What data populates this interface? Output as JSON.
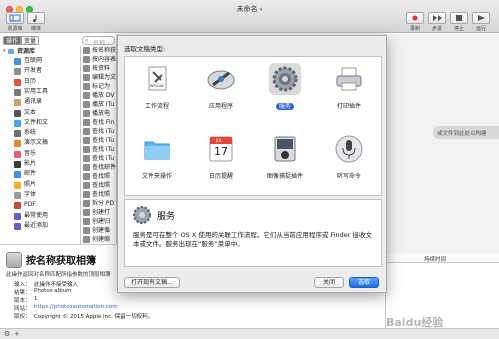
{
  "window": {
    "title": "未命名",
    "title_suffix": "▾"
  },
  "toolbar": {
    "library_label": "资源库",
    "media_label": "媒体",
    "record_label": "录制",
    "step_label": "步进",
    "stop_label": "停止",
    "run_label": "运行"
  },
  "tabs": {
    "actions": "操作",
    "variables": "变量"
  },
  "search": {
    "placeholder": "名称"
  },
  "library": {
    "header": "资源库",
    "items": [
      {
        "label": "互联网",
        "color": "#4a90d9"
      },
      {
        "label": "开发者",
        "color": "#8e8e93"
      },
      {
        "label": "日历",
        "color": "#e5533d"
      },
      {
        "label": "实用工具",
        "color": "#7a7a7a"
      },
      {
        "label": "通讯录",
        "color": "#c8a06a"
      },
      {
        "label": "文本",
        "color": "#555555"
      },
      {
        "label": "文件和文件夹",
        "color": "#4aa3f0"
      },
      {
        "label": "系统",
        "color": "#6d6d6d"
      },
      {
        "label": "演示文稿",
        "color": "#e08a2c"
      },
      {
        "label": "音乐",
        "color": "#f25a7a"
      },
      {
        "label": "影片",
        "color": "#3b3b3b"
      },
      {
        "label": "邮件",
        "color": "#3d8fe8"
      },
      {
        "label": "照片",
        "color": "#f0b429"
      },
      {
        "label": "字体",
        "color": "#9a9a9a"
      },
      {
        "label": "PDF",
        "color": "#c94b3b"
      },
      {
        "label": "最常使用的",
        "color": "#6a5acd"
      },
      {
        "label": "最近添加",
        "color": "#6a5acd"
      }
    ]
  },
  "actions": {
    "items": [
      "按名称获",
      "按内容表",
      "按资料",
      "编辑为文",
      "标记为",
      "播放 DV",
      "播放 iTu",
      "播放电",
      "查找 Fin",
      "查找 iTu",
      "查找 iTu",
      "查找 iTu",
      "查找 iTu",
      "查找邮件",
      "查找照",
      "查找照",
      "查找照",
      "拆分 PD",
      "创建打",
      "创建归",
      "创建循",
      "创建缩"
    ]
  },
  "info": {
    "title": "按名称获取相簿",
    "description": "此操作返回对名称匹配所指参数的顶层相簿",
    "rows": [
      {
        "k": "输入：",
        "v": "此操作不接受输入"
      },
      {
        "k": "结果：",
        "v": "Photos album"
      },
      {
        "k": "版本：",
        "v": "1"
      },
      {
        "k": "网站：",
        "v": "https://photosautomation.com"
      },
      {
        "k": "版权：",
        "v": "Copyright © 2015 Apple Inc. 保留一切权利。"
      }
    ]
  },
  "log": {
    "column": "持续时间",
    "hint": "或文件到此处以构建"
  },
  "dialog": {
    "title": "选取文稿类型:",
    "types": [
      {
        "label": "工作流程",
        "icon": "workflow-icon"
      },
      {
        "label": "应用程序",
        "icon": "application-icon"
      },
      {
        "label": "服务",
        "icon": "service-gear-icon"
      },
      {
        "label": "打印插件",
        "icon": "printer-icon"
      },
      {
        "label": "文件夹操作",
        "icon": "folder-icon"
      },
      {
        "label": "日历提醒",
        "icon": "calendar-icon"
      },
      {
        "label": "图像捕捉插件",
        "icon": "camera-icon"
      },
      {
        "label": "听写命令",
        "icon": "microphone-icon"
      }
    ],
    "calendar_month": "JUL",
    "calendar_day": "17",
    "workflow_tag": "WFLOW",
    "selected_index": 2,
    "desc_title": "服务",
    "desc_text": "服务是可在整个 OS X 使用的关联工作流程。它们从当前应用程序或 Finder 接收文本或文件。服务出现在“服务”菜单中。",
    "open_existing": "打开现有文稿...",
    "close": "关闭",
    "choose": "选取"
  },
  "watermark": "Baidu经验"
}
